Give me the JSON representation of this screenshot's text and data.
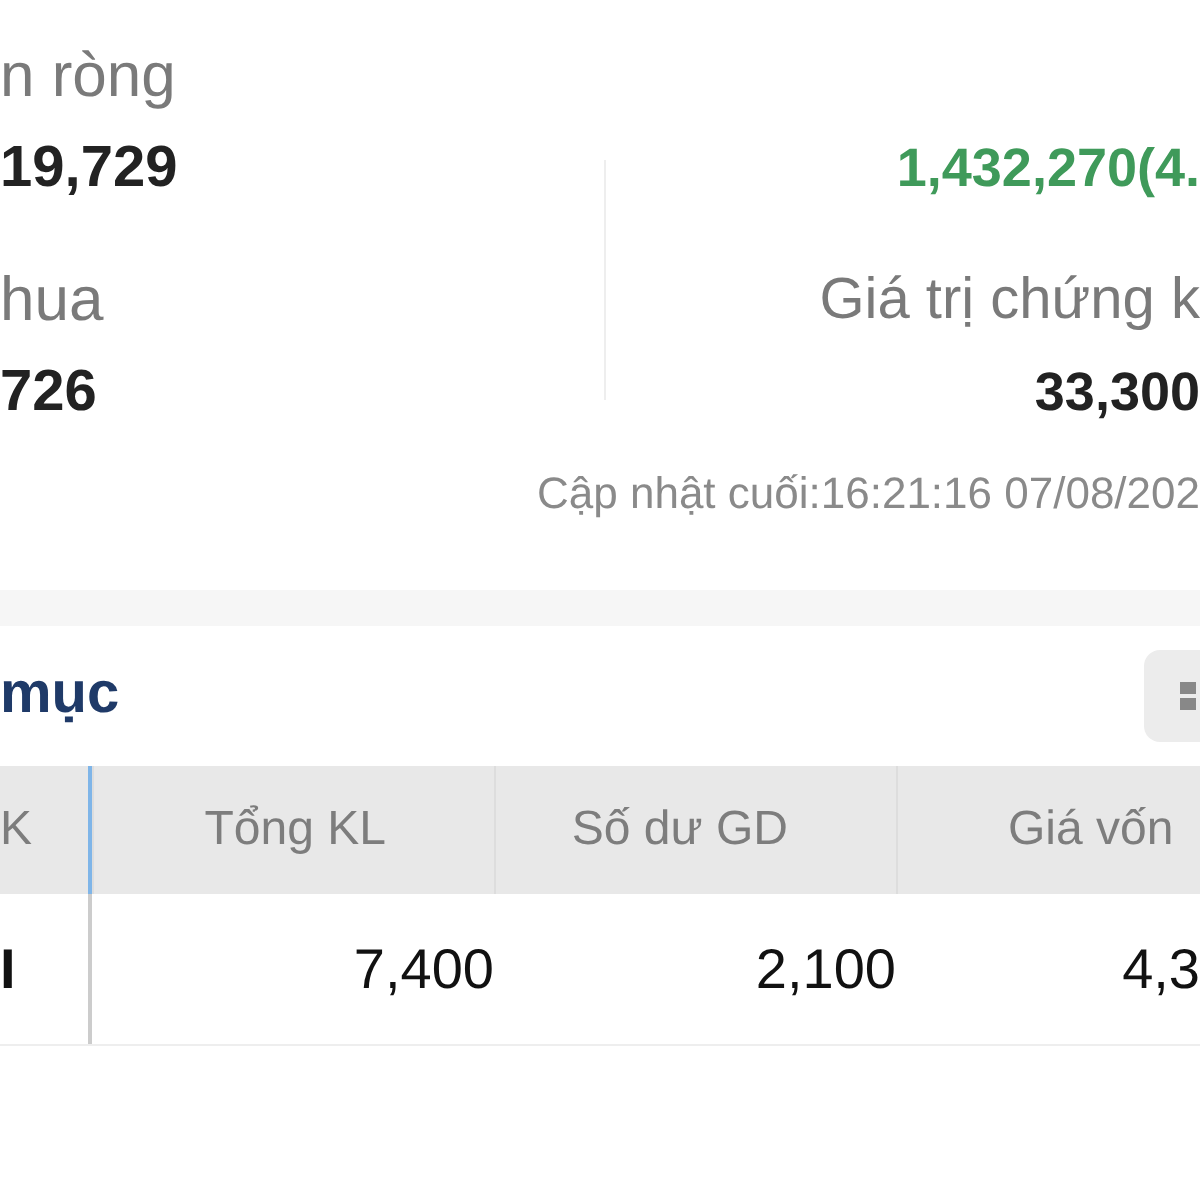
{
  "summary": {
    "left": [
      {
        "label": "n ròng",
        "value": "19,729"
      },
      {
        "label": "hua",
        "value": "726"
      }
    ],
    "right": [
      {
        "value": "1,432,270(4.",
        "positive": true
      },
      {
        "label": "Giá trị chứng k",
        "value": "33,300",
        "positive": false
      }
    ],
    "updated": "Cập nhật cuối:16:21:16 07/08/202"
  },
  "section": {
    "title": "mục"
  },
  "table": {
    "columns": [
      "K",
      "Tổng KL",
      "Số dư GD",
      "Giá vốn"
    ],
    "rows": [
      [
        "I",
        "7,400",
        "2,100",
        "4,3"
      ]
    ]
  }
}
